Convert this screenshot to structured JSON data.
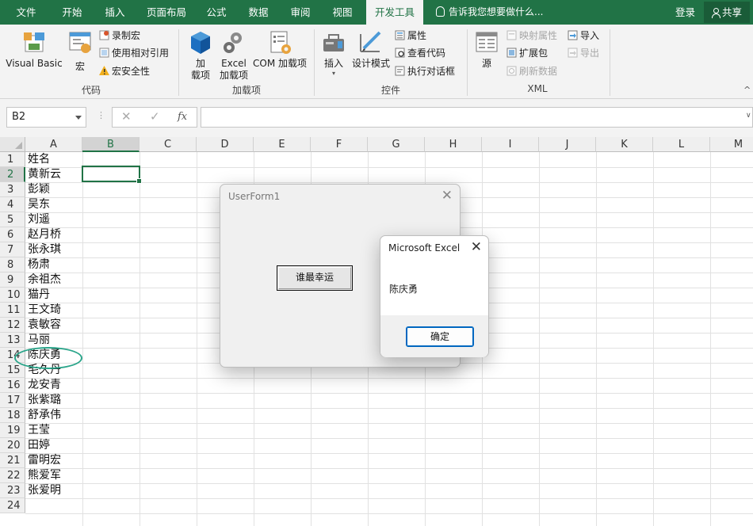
{
  "tabs": [
    {
      "label": "文件"
    },
    {
      "label": "开始"
    },
    {
      "label": "插入"
    },
    {
      "label": "页面布局"
    },
    {
      "label": "公式"
    },
    {
      "label": "数据"
    },
    {
      "label": "审阅"
    },
    {
      "label": "视图"
    },
    {
      "label": "开发工具",
      "active": true
    }
  ],
  "tell_me": "告诉我您想要做什么...",
  "login": "登录",
  "share": "共享",
  "ribbon": {
    "code": {
      "visual_basic": "Visual Basic",
      "macros": "宏",
      "record_macro": "录制宏",
      "relative_ref": "使用相对引用",
      "macro_security": "宏安全性",
      "group_label": "代码"
    },
    "addins": {
      "addins_1": "加",
      "addins_2": "载项",
      "excel_addins_1": "Excel",
      "excel_addins_2": "加载项",
      "com_addins": "COM 加载项",
      "group_label": "加载项"
    },
    "controls": {
      "insert": "插入",
      "design_mode": "设计模式",
      "properties": "属性",
      "view_code": "查看代码",
      "run_dialog": "执行对话框",
      "group_label": "控件"
    },
    "xml": {
      "source": "源",
      "map_properties": "映射属性",
      "expansion_packs": "扩展包",
      "refresh_data": "刷新数据",
      "import": "导入",
      "export": "导出",
      "group_label": "XML"
    }
  },
  "formula_bar": {
    "name_box": "B2",
    "cancel_icon": "✕",
    "enter_icon": "✓",
    "fx": "fx",
    "formula": ""
  },
  "columns": [
    "A",
    "B",
    "C",
    "D",
    "E",
    "F",
    "G",
    "H",
    "I",
    "J",
    "K",
    "L",
    "M"
  ],
  "selected_column": "B",
  "rows": [
    "1",
    "2",
    "3",
    "4",
    "5",
    "6",
    "7",
    "8",
    "9",
    "10",
    "11",
    "12",
    "13",
    "14",
    "15",
    "16",
    "17",
    "18",
    "19",
    "20",
    "21",
    "22",
    "23",
    "24"
  ],
  "selected_row": "2",
  "column_a": [
    "姓名",
    "黄新云",
    "彭颖",
    "吴东",
    "刘遥",
    "赵月桥",
    "张永琪",
    "杨肃",
    "余祖杰",
    "猫丹",
    "王文琦",
    "袁敏容",
    "马丽",
    "陈庆勇",
    "毛久丹",
    "龙安青",
    "张紫璐",
    "舒承伟",
    "王莹",
    "田婷",
    "雷明宏",
    "熊爱军",
    "张爱明",
    ""
  ],
  "userform": {
    "title": "UserForm1",
    "close": "✕",
    "button": "谁最幸运"
  },
  "msgbox": {
    "title": "Microsoft Excel",
    "close": "✕",
    "message": "陈庆勇",
    "ok": "确定"
  }
}
